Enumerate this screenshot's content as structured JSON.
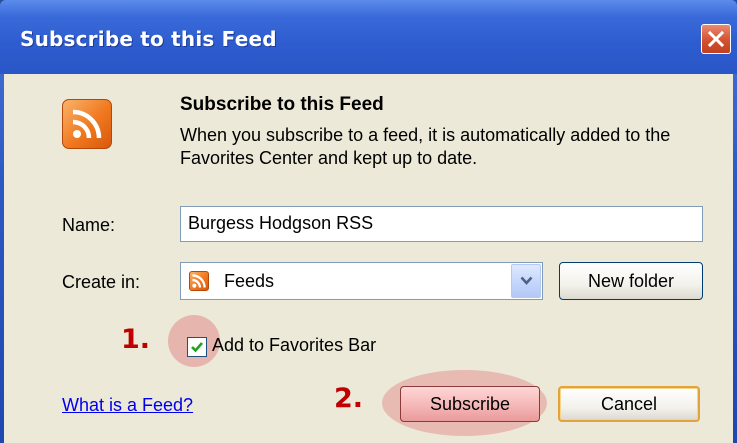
{
  "window": {
    "title": "Subscribe to this Feed"
  },
  "header": {
    "heading": "Subscribe to this Feed",
    "description": "When you subscribe to a feed, it is automatically added to the Favorites Center and kept up to date."
  },
  "form": {
    "name_label": "Name:",
    "name_value": "Burgess Hodgson RSS",
    "create_in_label": "Create in:",
    "create_in_value": "Feeds",
    "new_folder_label": "New folder",
    "add_to_favorites_label": "Add to Favorites Bar",
    "add_to_favorites_checked": true
  },
  "annotations": {
    "step1": "1.",
    "step2": "2."
  },
  "footer": {
    "help_link": "What is a Feed?",
    "subscribe_label": "Subscribe",
    "cancel_label": "Cancel"
  },
  "icons": {
    "feed": "rss-feed-icon",
    "close": "close-icon",
    "dropdown": "chevron-down-icon",
    "check": "checkmark-icon"
  },
  "colors": {
    "title_bar": "#2d5ccf",
    "dialog_bg": "#ece9d8",
    "rss_orange": "#f0781f",
    "annotation_red": "#c00000",
    "highlight_pink": "#e18c8c",
    "link_blue": "#0000ee"
  }
}
